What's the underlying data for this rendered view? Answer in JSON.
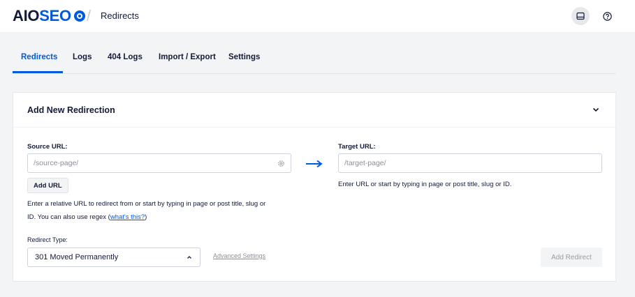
{
  "header": {
    "logo_part1": "AIO",
    "logo_part2": "SEO",
    "breadcrumb": "Redirects",
    "icons": [
      "inbox-icon",
      "help-icon"
    ]
  },
  "tabs": [
    {
      "label": "Redirects",
      "active": true
    },
    {
      "label": "Logs",
      "active": false
    },
    {
      "label": "404 Logs",
      "active": false
    },
    {
      "label": "Import / Export",
      "active": false
    },
    {
      "label": "Settings",
      "active": false
    }
  ],
  "card": {
    "title": "Add New Redirection",
    "source": {
      "label": "Source URL:",
      "placeholder": "/source-page/",
      "add_button": "Add URL",
      "help_line1": "Enter a relative URL to redirect from or start by typing in page or post title, slug or",
      "help_line2_prefix": "ID. You can also use regex (",
      "help_link": "what's this?",
      "help_line2_suffix": ")"
    },
    "target": {
      "label": "Target URL:",
      "placeholder": "/target-page/",
      "help": "Enter URL or start by typing in page or post title, slug or ID."
    },
    "redirect_type": {
      "label": "Redirect Type:",
      "selected": "301 Moved Permanently"
    },
    "advanced_settings": "Advanced Settings",
    "add_redirect_button": "Add Redirect"
  },
  "colors": {
    "accent": "#005ae0",
    "text": "#141b38",
    "background": "#f3f4f5"
  }
}
